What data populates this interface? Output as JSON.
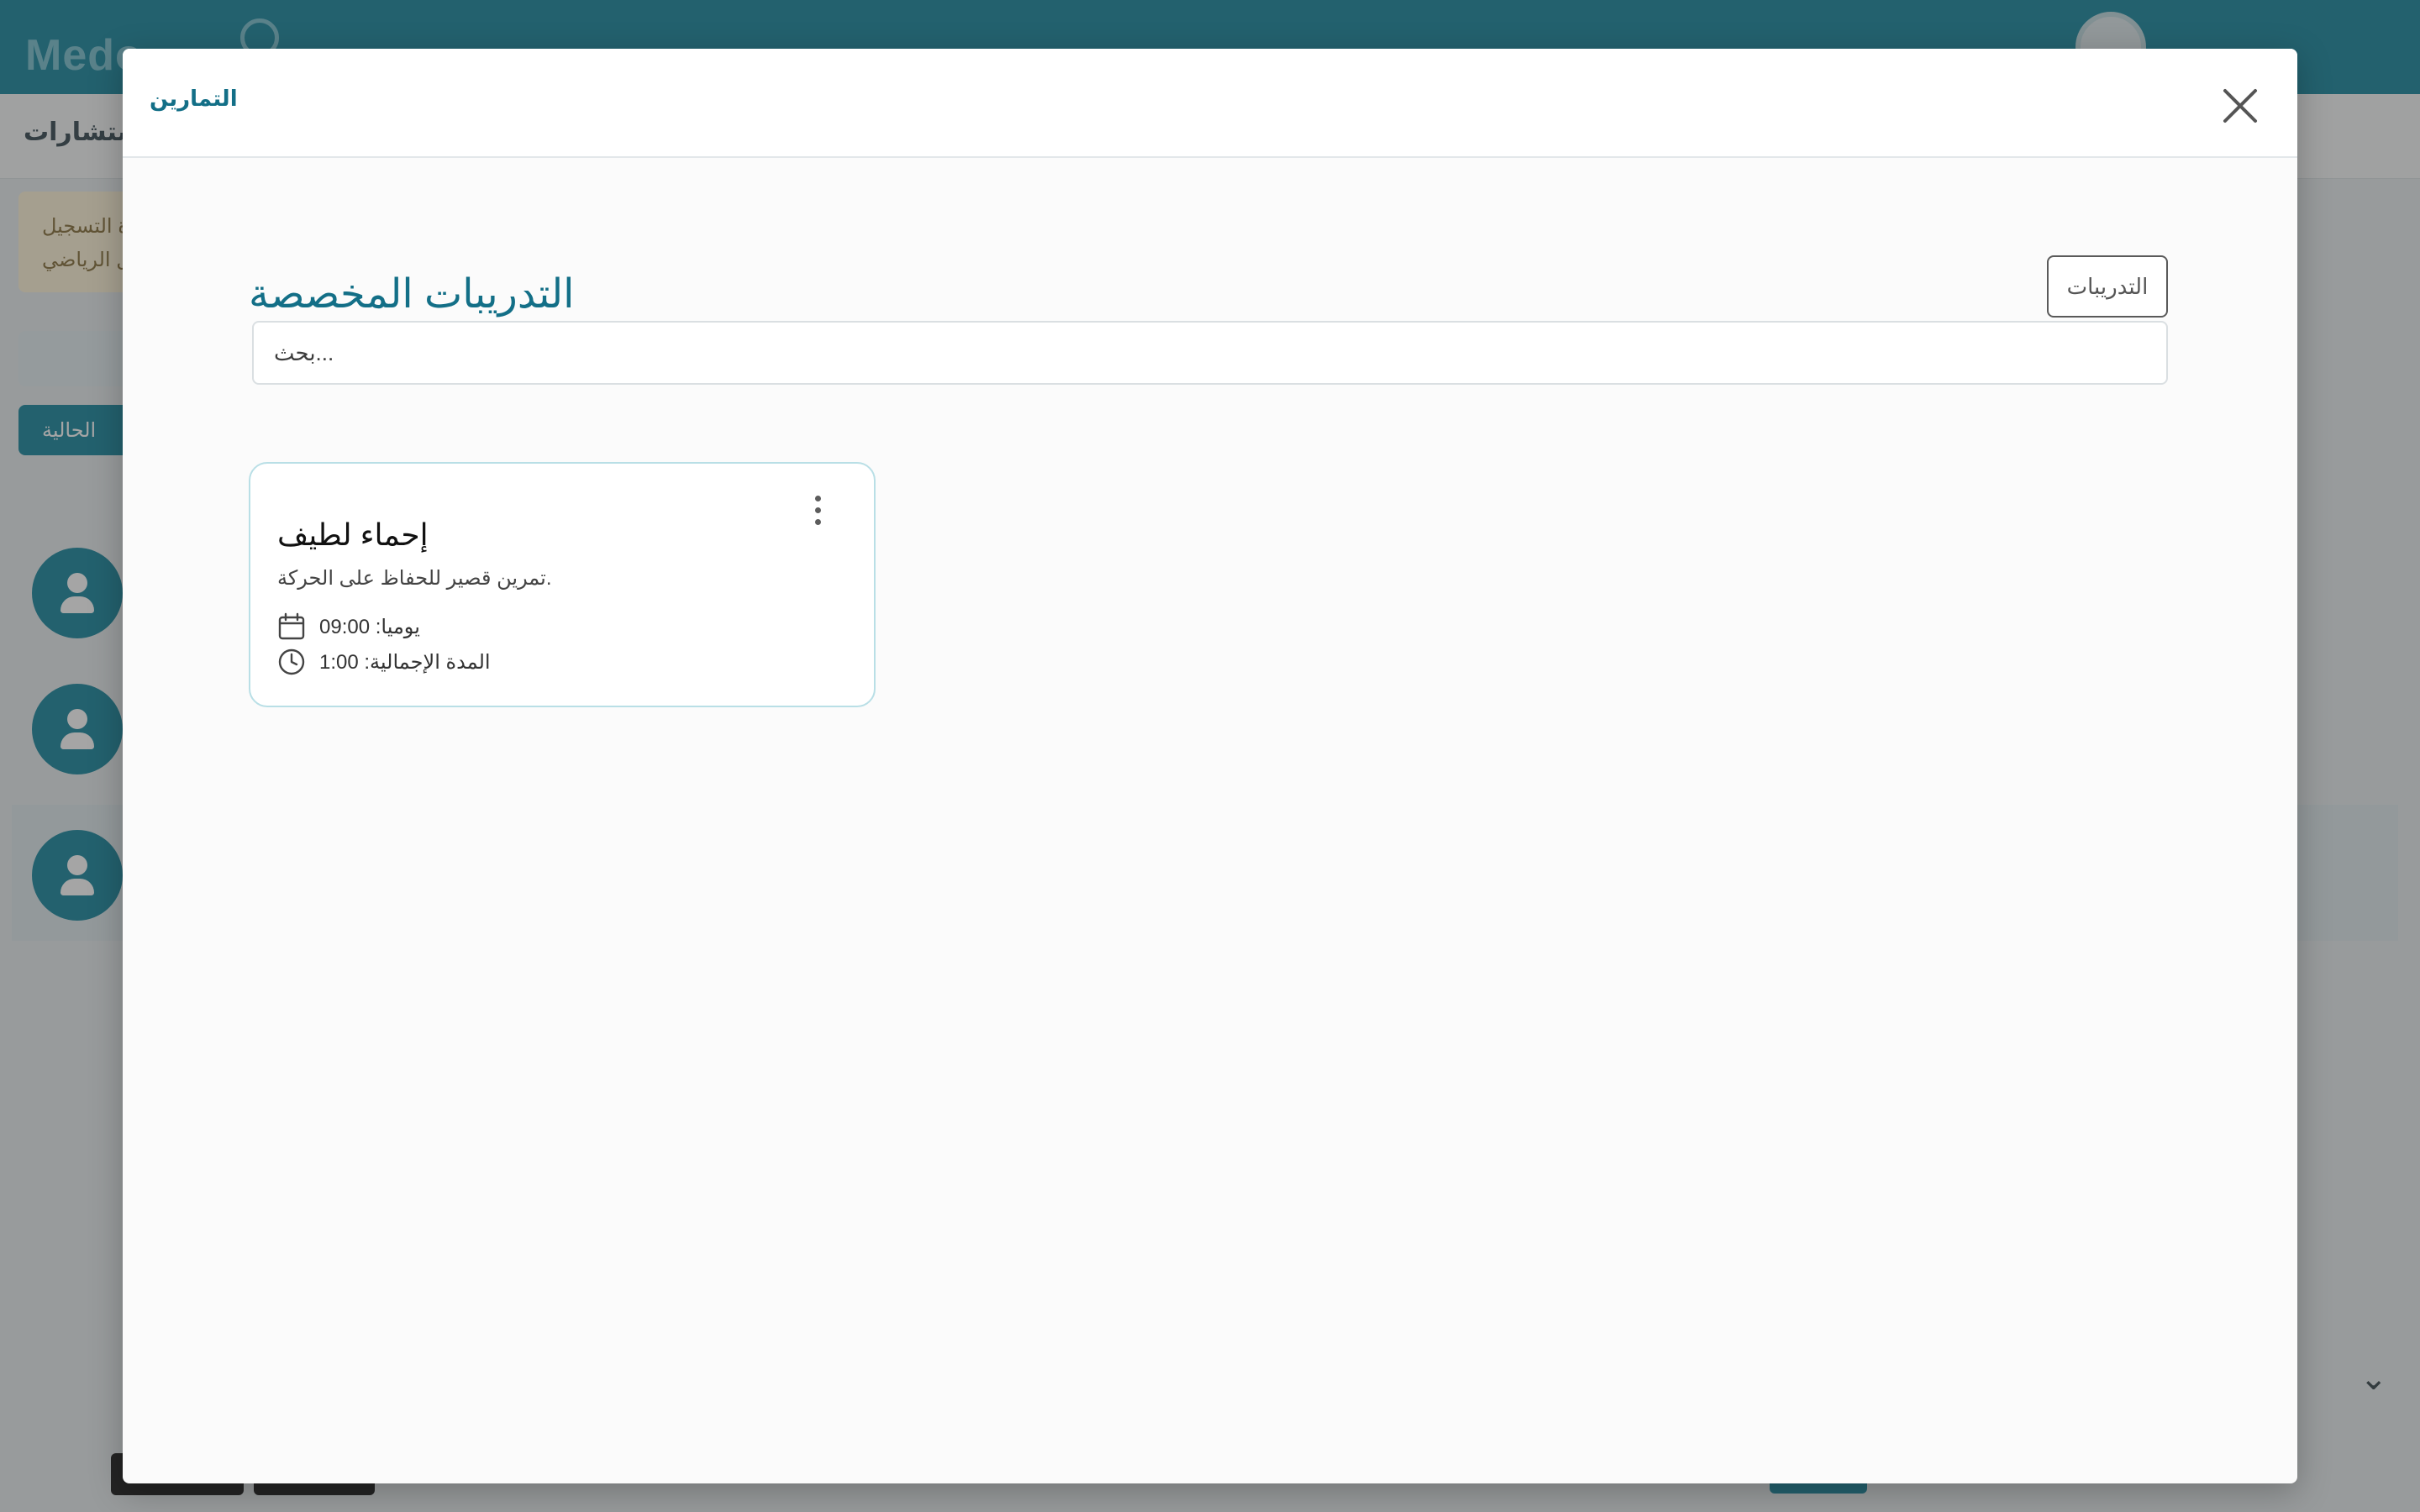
{
  "background_app": {
    "logo_text": "Medo",
    "subnav_label": "ستشارات",
    "side_card_lines": [
      "ة التسجيل",
      "ل الرياضي"
    ],
    "side_button_label": "الحالية"
  },
  "modal": {
    "title": "التمارين",
    "close_icon": "close-icon"
  },
  "page": {
    "heading": "التدريبات المخصصة",
    "trainings_button_label": "التدريبات",
    "search": {
      "placeholder": "...بحث",
      "value": ""
    }
  },
  "workouts": [
    {
      "title": "إحماء لطيف",
      "description": ".تمرين قصير للحفاظ على الحركة",
      "schedule": "يوميا: 09:00",
      "schedule_icon": "calendar-icon",
      "duration": "المدة الإجمالية: 1:00",
      "duration_icon": "clock-icon",
      "menu_icon": "more-vertical-icon"
    }
  ],
  "colors": {
    "accent": "#136f87",
    "topbar": "#1f8aa1",
    "card_border": "#b9dfe6"
  }
}
